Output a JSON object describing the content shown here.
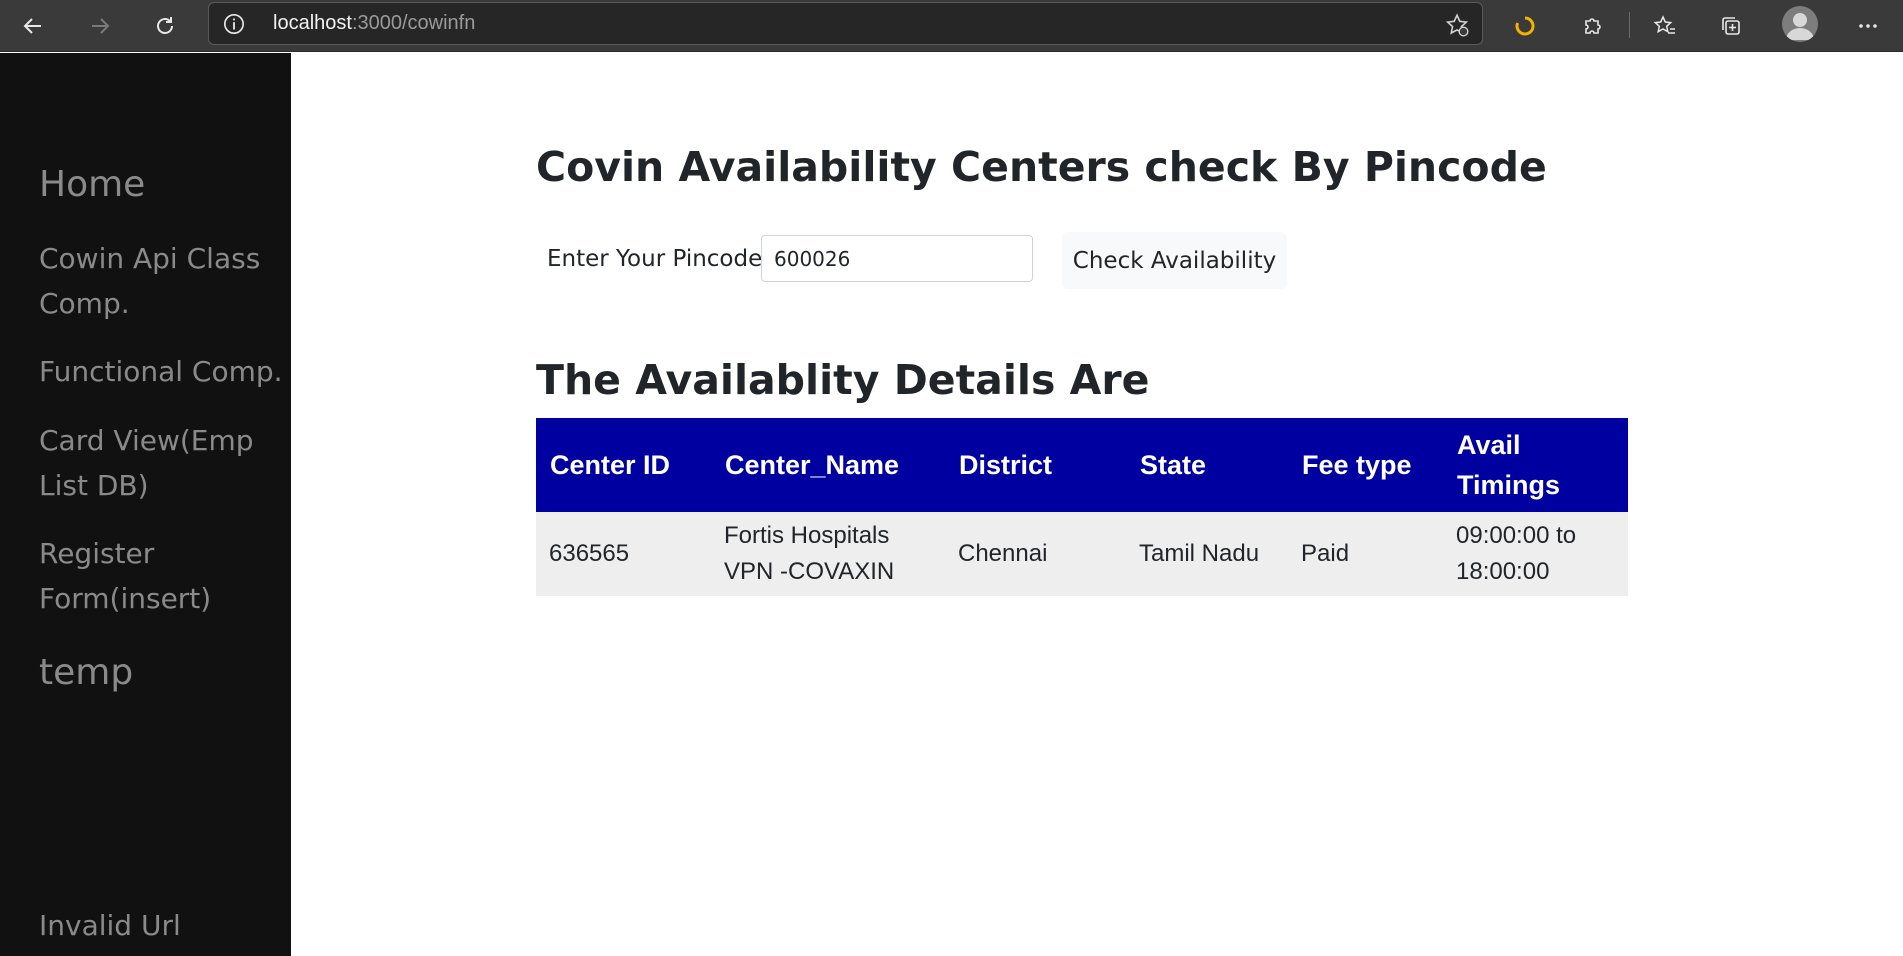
{
  "browser": {
    "url_host": "localhost",
    "url_path": ":3000/cowinfn"
  },
  "sidebar": {
    "items": [
      {
        "label": "Home"
      },
      {
        "label": "Cowin Api Class Comp."
      },
      {
        "label": "Functional Comp."
      },
      {
        "label": "Card View(Emp List DB)"
      },
      {
        "label": "Register Form(insert)"
      },
      {
        "label": "temp"
      },
      {
        "label": "Invalid Url"
      }
    ]
  },
  "main": {
    "title": "Covin Availability Centers check By Pincode",
    "pincode_label": "Enter Your Pincode",
    "pincode_value": "600026",
    "check_button": "Check Availability",
    "details_heading": "The Availablity Details Are"
  },
  "table": {
    "headers": [
      "Center ID",
      "Center_Name",
      "District",
      "State",
      "Fee type",
      "Avail Timings"
    ],
    "rows": [
      [
        "636565",
        "Fortis Hospitals VPN -COVAXIN",
        "Chennai",
        "Tamil Nadu",
        "Paid",
        "09:00:00 to 18:00:00"
      ]
    ]
  },
  "colors": {
    "sidebar_bg": "#111111",
    "table_header_bg": "#0000a0",
    "table_row_bg": "#eeeeee"
  }
}
